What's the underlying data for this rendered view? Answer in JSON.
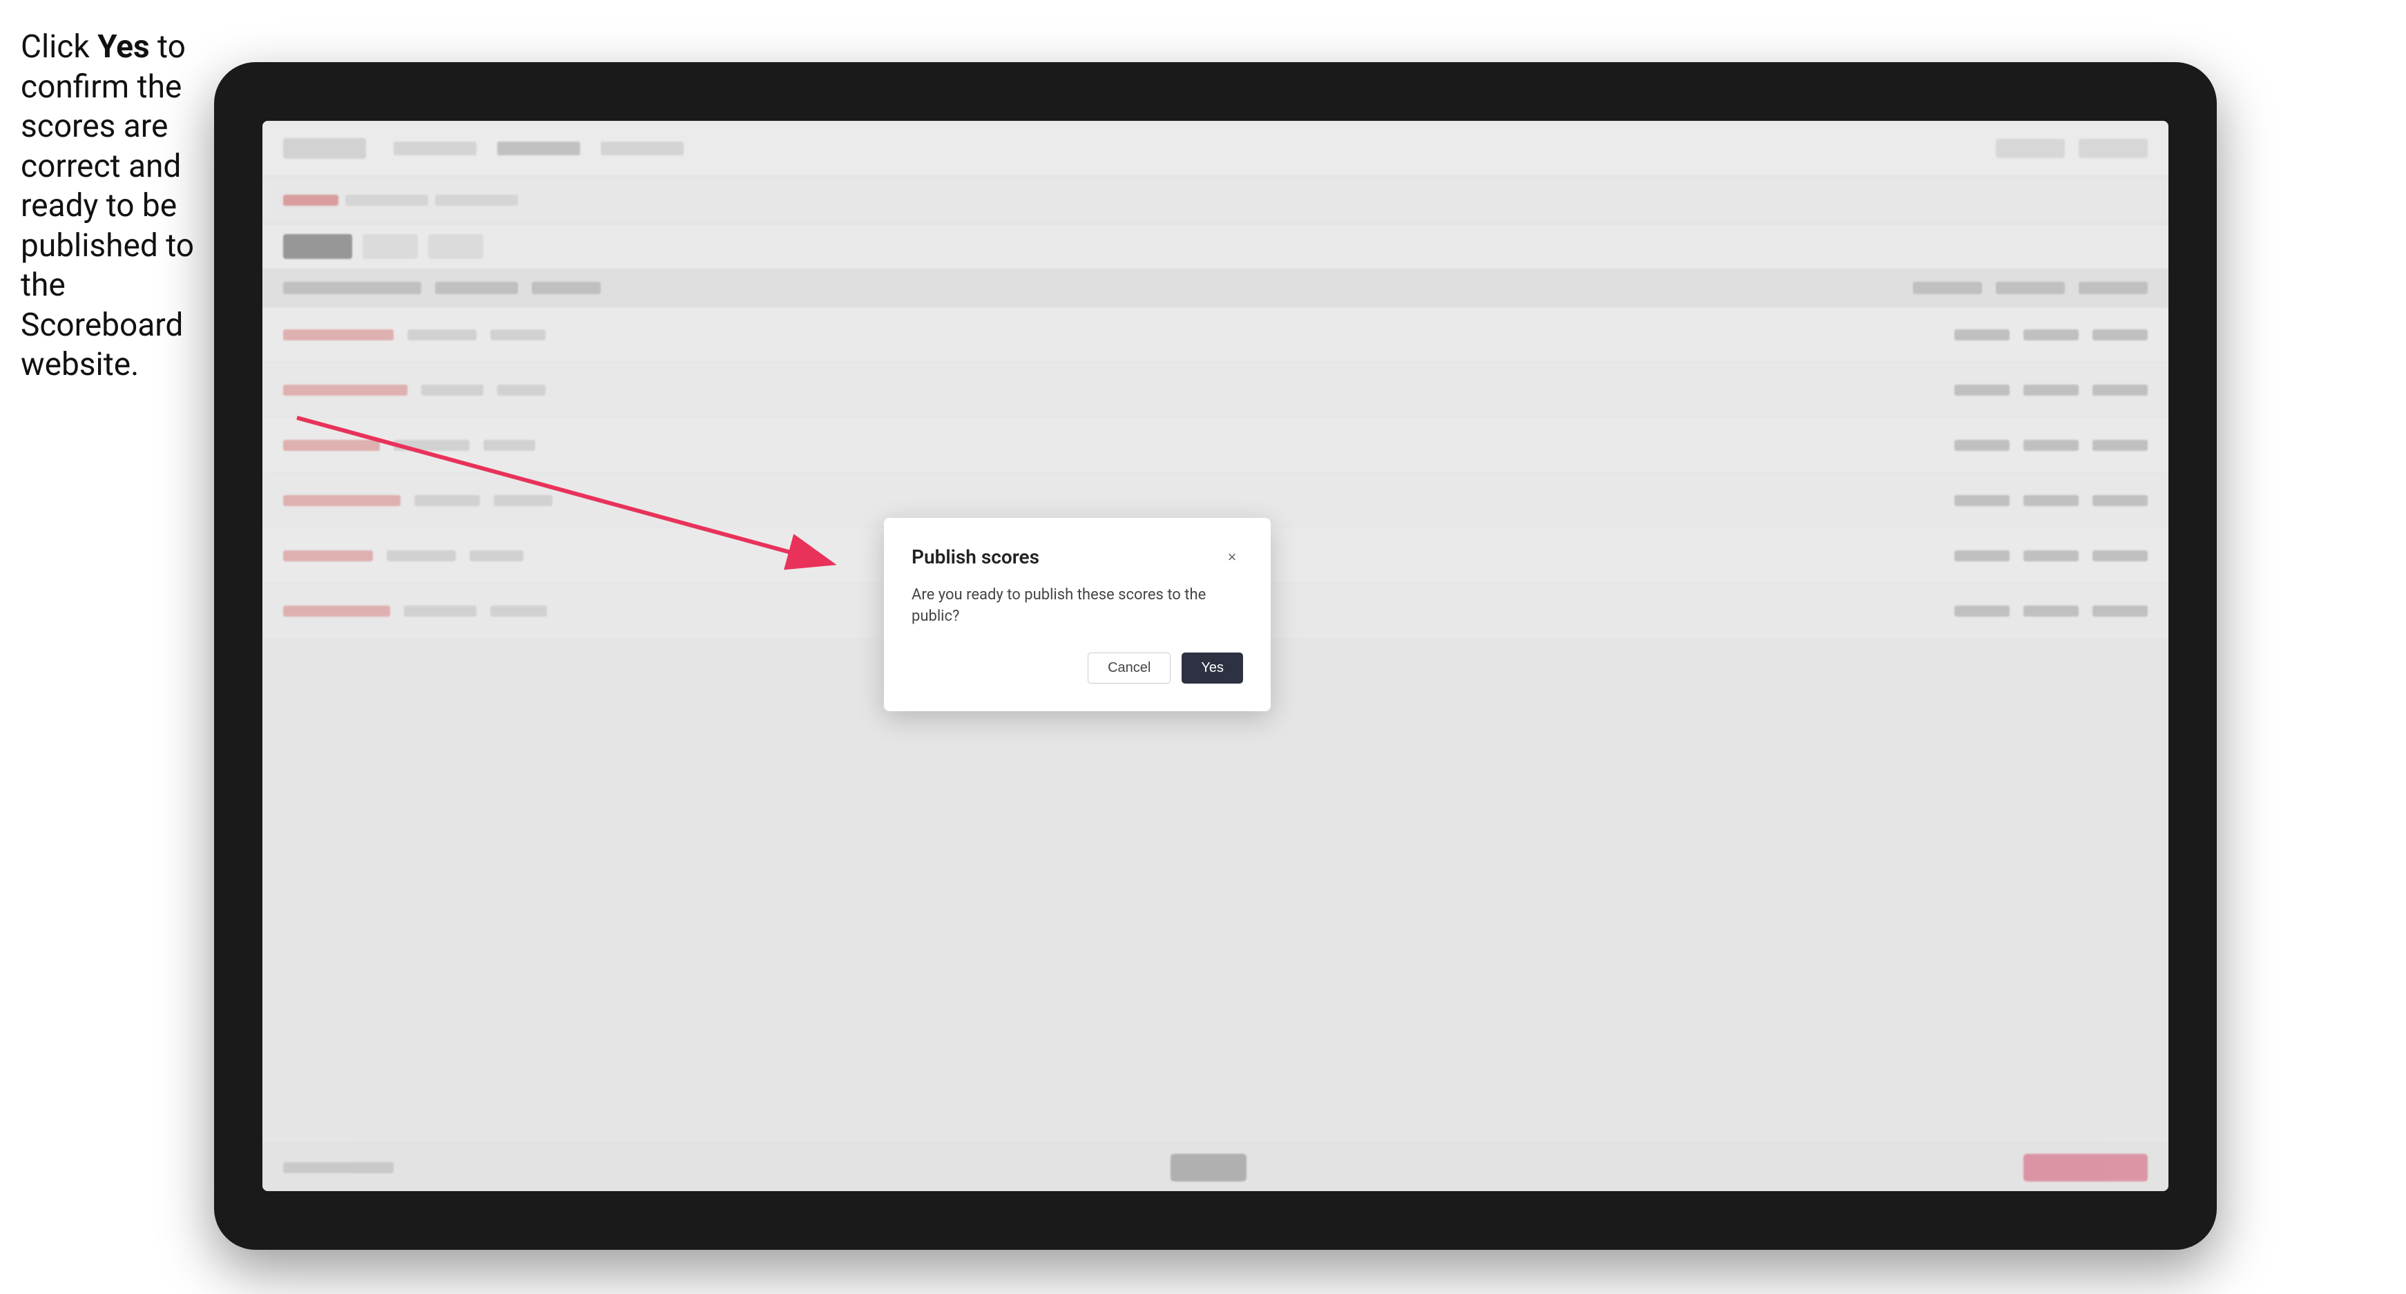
{
  "instruction": {
    "text_part1": "Click ",
    "bold": "Yes",
    "text_part2": " to confirm the scores are correct and ready to be published to the Scoreboard website."
  },
  "dialog": {
    "title": "Publish scores",
    "body": "Are you ready to publish these scores to the public?",
    "cancel_label": "Cancel",
    "yes_label": "Yes",
    "close_icon": "×"
  },
  "arrow": {
    "color": "#e8325a"
  }
}
